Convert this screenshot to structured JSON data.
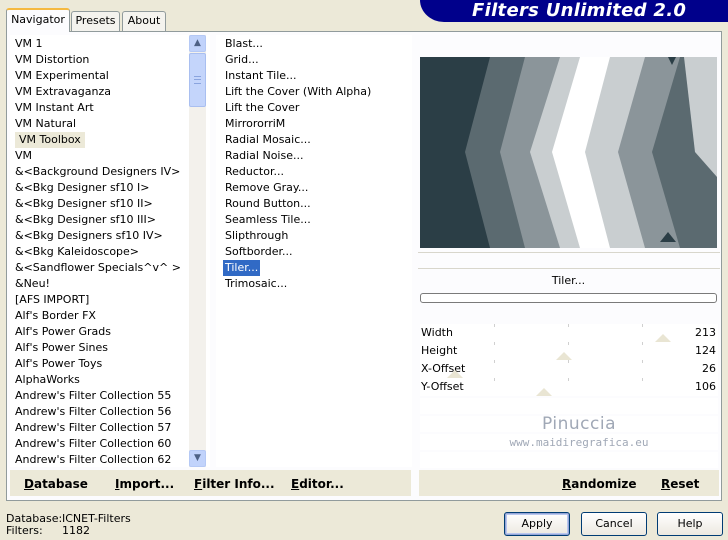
{
  "banner": {
    "title": "Filters Unlimited 2.0"
  },
  "tabs": [
    {
      "label": "Navigator",
      "active": true
    },
    {
      "label": "Presets",
      "active": false
    },
    {
      "label": "About",
      "active": false
    }
  ],
  "categories": [
    "VM 1",
    "VM Distortion",
    "VM Experimental",
    "VM Extravaganza",
    "VM Instant Art",
    "VM Natural",
    "VM Toolbox",
    "VM",
    "&<Background Designers IV>",
    "&<Bkg Designer sf10 I>",
    "&<Bkg Designer sf10 II>",
    "&<Bkg Designer sf10 III>",
    "&<Bkg Designers sf10 IV>",
    "&<Bkg Kaleidoscope>",
    "&<Sandflower Specials^v^ >",
    "&Neu!",
    "[AFS IMPORT]",
    "Alf's Border FX",
    "Alf's Power Grads",
    "Alf's Power Sines",
    "Alf's Power Toys",
    "AlphaWorks",
    "Andrew's Filter Collection 55",
    "Andrew's Filter Collection 56",
    "Andrew's Filter Collection 57",
    "Andrew's Filter Collection 60",
    "Andrew's Filter Collection 62"
  ],
  "selected_category": "VM Toolbox",
  "filters": [
    "Blast...",
    "Grid...",
    "Instant Tile...",
    "Lift the Cover (With Alpha)",
    "Lift the Cover",
    "MirrororriM",
    "Radial Mosaic...",
    "Radial Noise...",
    "Reductor...",
    "Remove Gray...",
    "Round Button...",
    "Seamless Tile...",
    "Slipthrough",
    "Softborder...",
    "Tiler...",
    "Trimosaic..."
  ],
  "selected_filter": "Tiler...",
  "preview": {
    "filter_name": "Tiler..."
  },
  "params": [
    {
      "name": "Width",
      "value": "213",
      "level": 0.835
    },
    {
      "name": "Height",
      "value": "124",
      "level": 0.486
    },
    {
      "name": "X-Offset",
      "value": "26",
      "level": 0.102
    },
    {
      "name": "Y-Offset",
      "value": "106",
      "level": 0.416
    }
  ],
  "watermark": {
    "name": "Pinuccia",
    "url": "www.maidiregrafica.eu"
  },
  "toolbar": {
    "database": "Database",
    "import": "Import...",
    "filter_info": "Filter Info...",
    "editor": "Editor...",
    "randomize": "Randomize",
    "reset": "Reset"
  },
  "status": {
    "database_label": "Database:",
    "database_value": "ICNET-Filters",
    "filters_label": "Filters:",
    "filters_value": "1182"
  },
  "buttons": {
    "apply": "Apply",
    "cancel": "Cancel",
    "help": "Help"
  },
  "colors": {
    "selection": "#316ac5",
    "banner": "#00008b",
    "preview_dark": "#2b3e46",
    "preview_mid": "#8b959a",
    "preview_light": "#c9ced0",
    "preview_white": "#ffffff"
  }
}
